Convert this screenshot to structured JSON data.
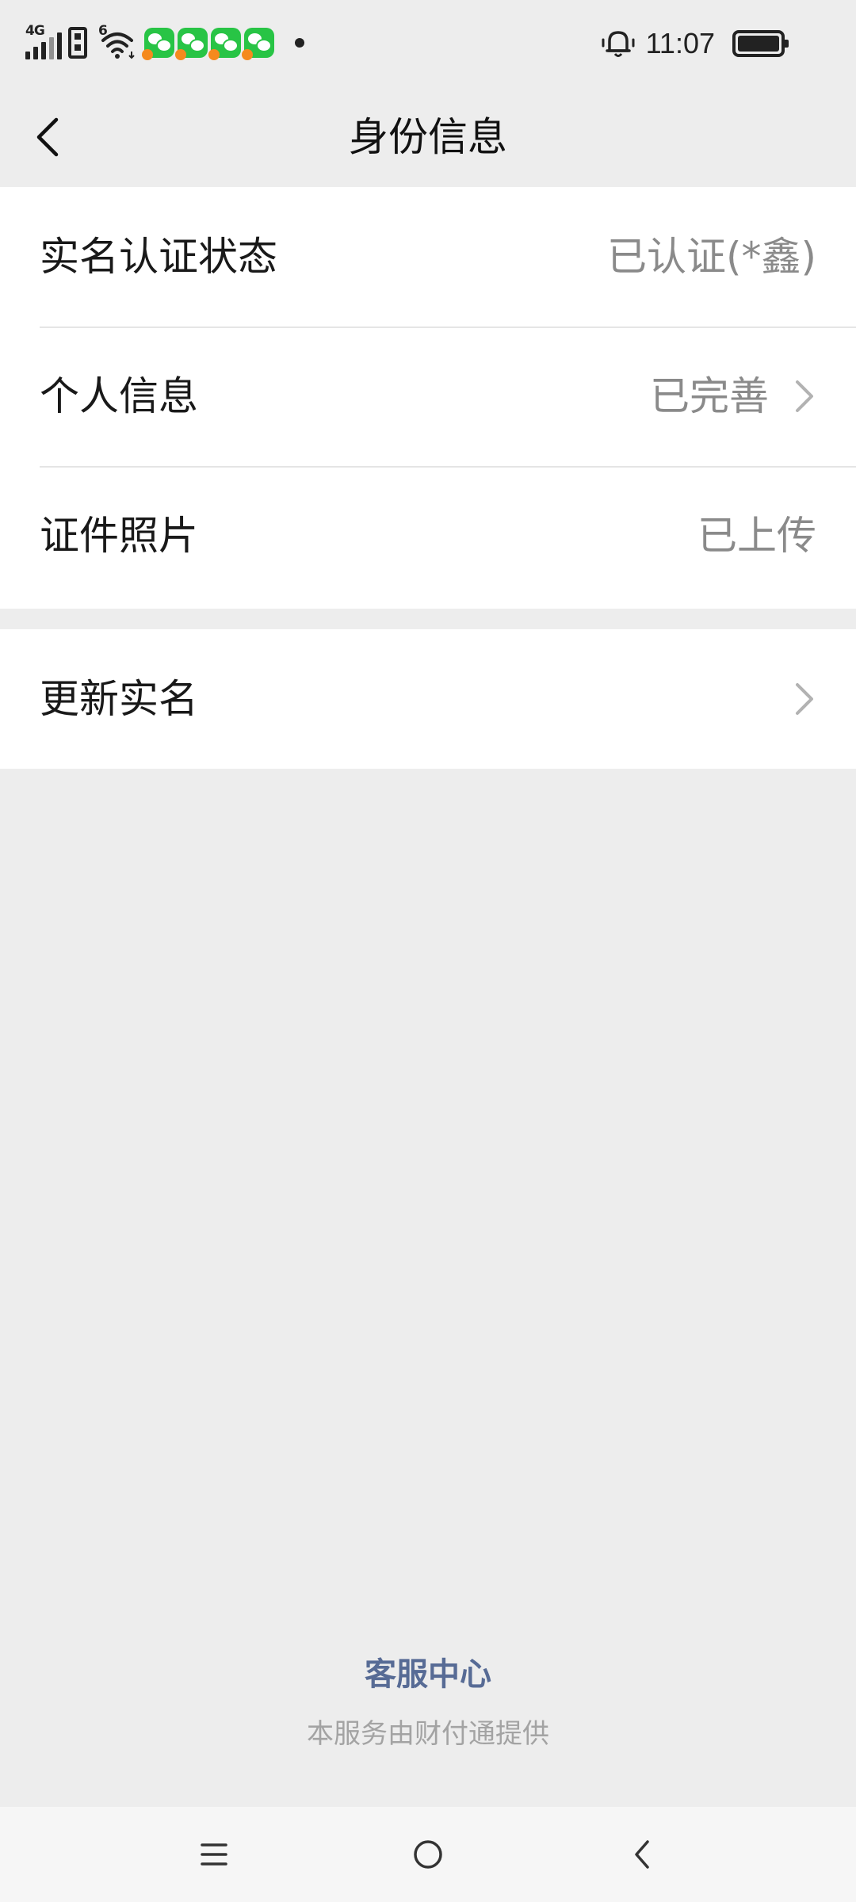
{
  "status_bar": {
    "network": "4G",
    "wifi_badge": "6",
    "time": "11:07",
    "icons": [
      "signal-icon",
      "sim-icon",
      "wifi-icon",
      "wechat-icon",
      "wechat-icon",
      "wechat-icon",
      "wechat-icon",
      "notification-dot-icon",
      "bell-icon",
      "battery-icon"
    ]
  },
  "header": {
    "title": "身份信息"
  },
  "info_group": {
    "rows": [
      {
        "label": "实名认证状态",
        "value": "已认证(*鑫)"
      },
      {
        "label": "个人信息",
        "value": "已完善"
      },
      {
        "label": "证件照片",
        "value": "已上传"
      }
    ]
  },
  "update_group": {
    "label": "更新实名"
  },
  "footer": {
    "link": "客服中心",
    "note": "本服务由财付通提供"
  },
  "colors": {
    "background": "#ededed",
    "link": "#576b95",
    "secondary_text": "#8a8a8a"
  }
}
